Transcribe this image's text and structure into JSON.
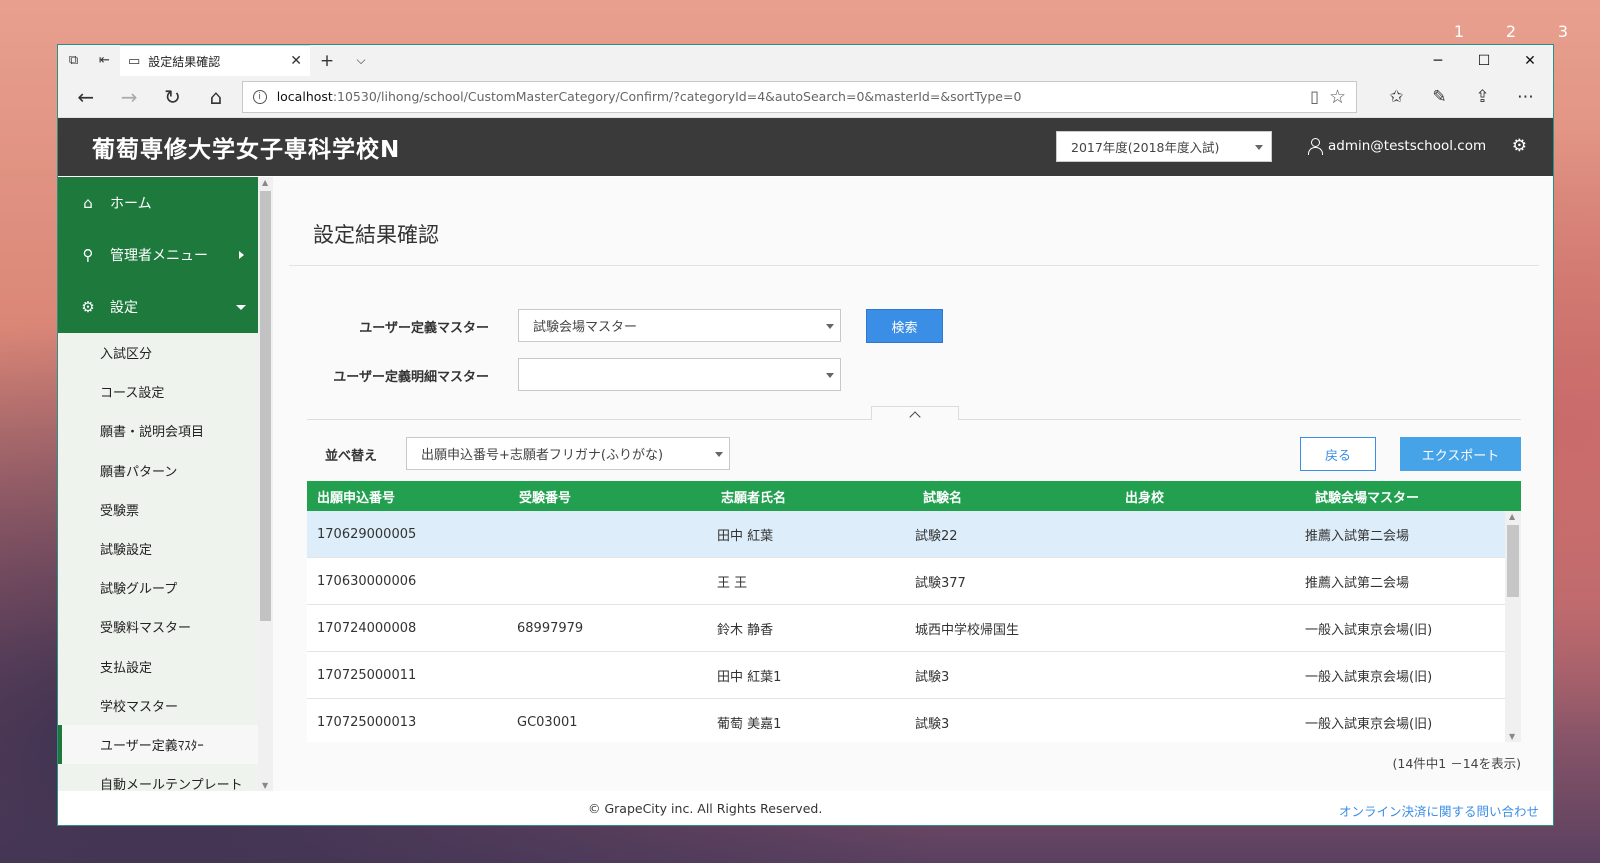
{
  "desktop": {
    "numbers": [
      "1",
      "2",
      "3"
    ]
  },
  "browser": {
    "tab_title": "設定結果確認",
    "url_host": "localhost",
    "url_rest": ":10530/lihong/school/CustomMasterCategory/Confirm/?categoryId=4&autoSearch=0&masterId=&sortType=0",
    "icons": [
      "tab-preview-icon",
      "set-aside-tabs-icon",
      "page-icon",
      "new-tab-icon",
      "tab-list-icon",
      "back-icon",
      "forward-icon",
      "refresh-icon",
      "home-icon",
      "info-icon",
      "reading-view-icon",
      "favorite-star-icon",
      "favorites-icon",
      "pen-icon",
      "share-icon",
      "more-icon"
    ]
  },
  "header": {
    "school_name": "葡萄専修大学女子専科学校N",
    "year_select": "2017年度(2018年度入試)",
    "user": "admin@testschool.com"
  },
  "sidebar": {
    "main_items": [
      {
        "label": "ホーム",
        "icon": "home-icon"
      },
      {
        "label": "管理者メニュー",
        "icon": "user-icon"
      },
      {
        "label": "設定",
        "icon": "gear-icon"
      }
    ],
    "sub_items": [
      "入試区分",
      "コース設定",
      "願書・説明会項目",
      "願書パターン",
      "受験票",
      "試験設定",
      "試験グループ",
      "受験料マスター",
      "支払設定",
      "学校マスター",
      "ユーザー定義ﾏｽﾀｰ",
      "自動メールテンプレート"
    ],
    "active_sub_index": 10
  },
  "page": {
    "title": "設定結果確認",
    "master_label": "ユーザー定義マスター",
    "master_value": "試験会場マスター",
    "detail_label": "ユーザー定義明細マスター",
    "detail_value": "",
    "search_button": "検索",
    "sort_label": "並べ替え",
    "sort_value": "出願申込番号+志願者フリガナ(ふりがな)",
    "back_button": "戻る",
    "export_button": "エクスポート"
  },
  "table": {
    "columns": [
      "出願申込番号",
      "受験番号",
      "志願者氏名",
      "試験名",
      "出身校",
      "試験会場マスター"
    ],
    "rows": [
      [
        "170629000005",
        "",
        "田中 紅葉",
        "試験22",
        "",
        "推薦入試第二会場"
      ],
      [
        "170630000006",
        "",
        "王 王",
        "試験377",
        "",
        "推薦入試第二会場"
      ],
      [
        "170724000008",
        "68997979",
        "鈴木 静香",
        "城西中学校帰国生",
        "",
        "一般入試東京会場(旧)"
      ],
      [
        "170725000011",
        "",
        "田中 紅葉1",
        "試験3",
        "",
        "一般入試東京会場(旧)"
      ],
      [
        "170725000013",
        "GC03001",
        "葡萄 美嘉1",
        "試験3",
        "",
        "一般入試東京会場(旧)"
      ]
    ],
    "selected_row": 0,
    "count_text": "(14件中1 －14を表示)"
  },
  "footer": {
    "copyright": "© GrapeCity inc. All Rights Reserved.",
    "contact_link": "オンライン決済に関する問い合わせ"
  }
}
